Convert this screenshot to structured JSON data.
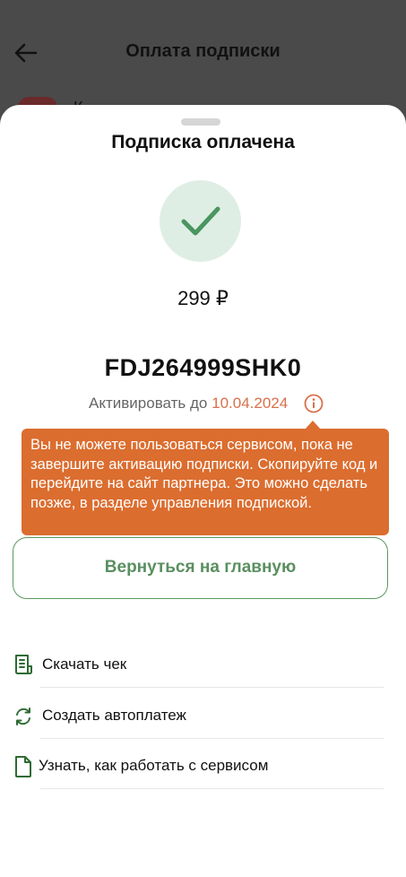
{
  "header": {
    "title": "Оплата подписки",
    "background_text": "К"
  },
  "sheet": {
    "title": "Подписка оплачена",
    "amount": "299 ₽",
    "code": "FDJ264999SHK0",
    "activate_label": "Активировать до",
    "activate_date": "10.04.2024",
    "tooltip_text": "Вы не можете пользоваться сервисом, пока не завершите активацию подписки. Скопируйте код и перейдите на сайт партнера. Это можно сделать позже, в разделе управления подпиской.",
    "home_button": "Вернуться на главную"
  },
  "menu": {
    "items": [
      {
        "label": "Скачать чек",
        "icon": "receipt-icon"
      },
      {
        "label": "Создать автоплатеж",
        "icon": "refresh-icon"
      },
      {
        "label": "Узнать, как работать с сервисом",
        "icon": "document-icon"
      }
    ]
  },
  "colors": {
    "accent_green": "#5a9a5e",
    "date_orange": "#d9704a",
    "tooltip_bg": "#db6d2f",
    "success_circle": "#dfeee4"
  }
}
